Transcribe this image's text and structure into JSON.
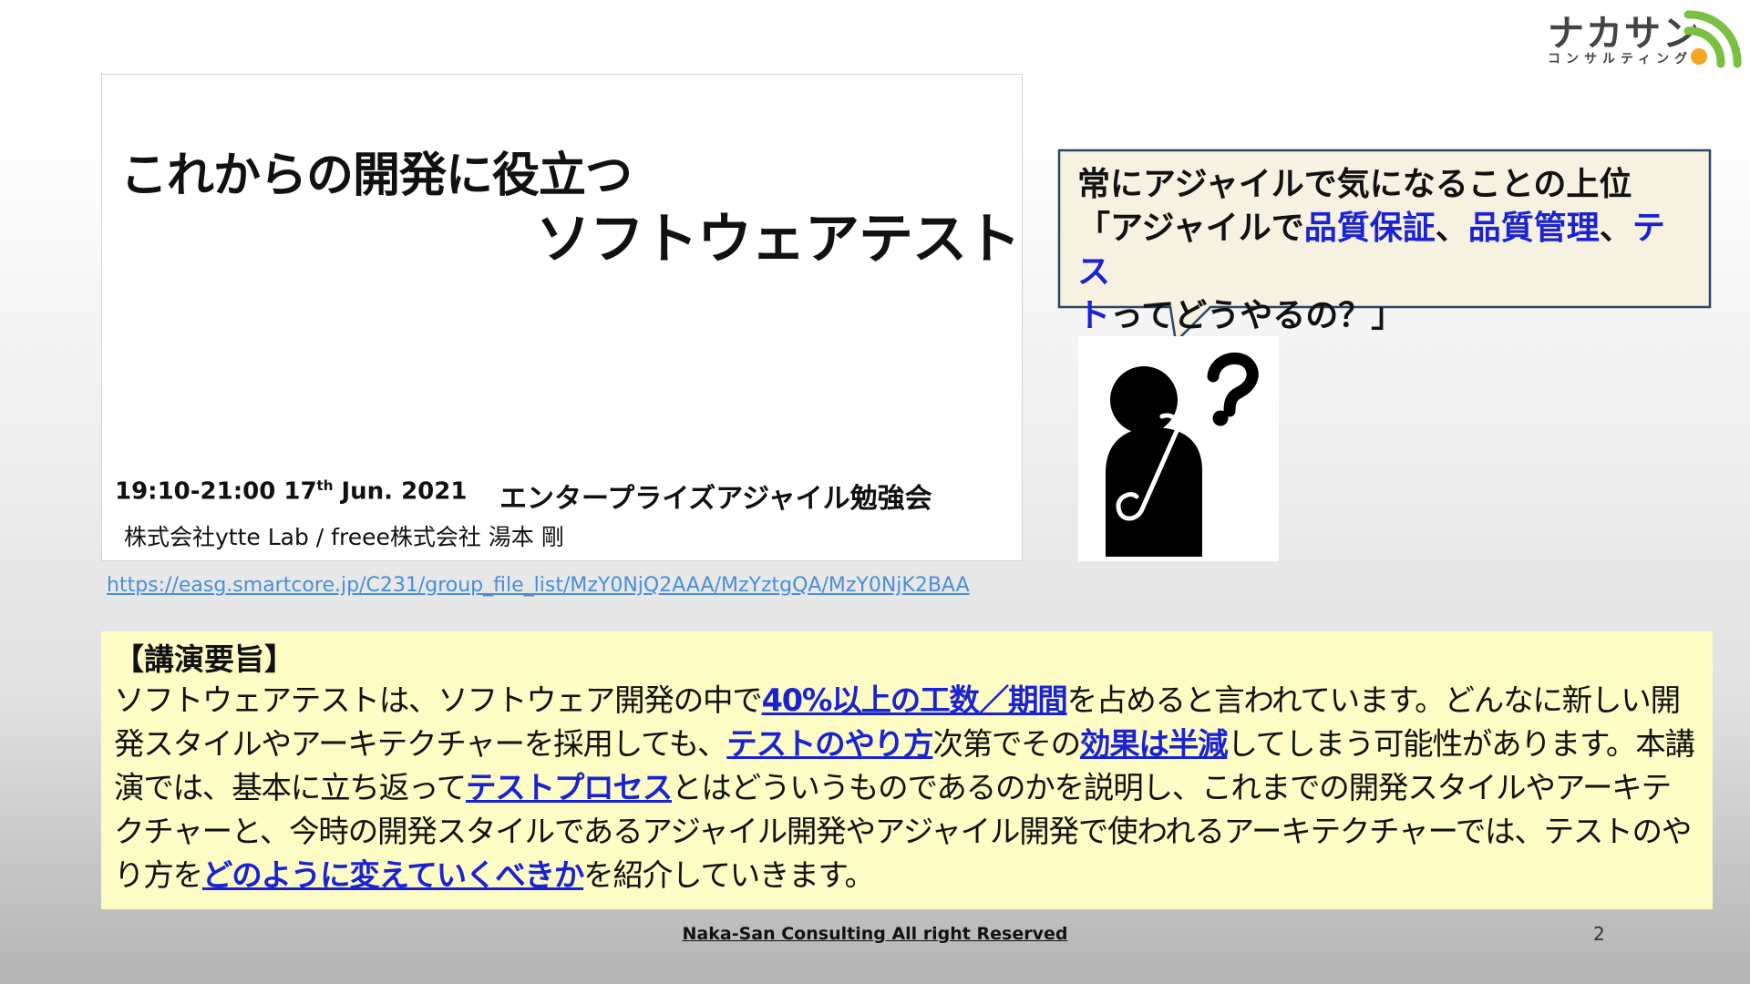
{
  "logo": {
    "main": "ナカサン",
    "sub": "コンサルティング",
    "colors": {
      "arc_green": "#7ac143",
      "arc_orange": "#f5a623"
    }
  },
  "slide_thumbnail": {
    "title_line1": "これからの開発に役立つ",
    "title_line2": "ソフトウェアテスト",
    "date_prefix": "19:10-21:00  17",
    "date_sup": "th",
    "date_suffix": " Jun. 2021",
    "event": "エンタープライズアジャイル勉強会",
    "author": "株式会社ytte Lab  / freee株式会社 湯本 剛"
  },
  "link": {
    "url": "https://easg.smartcore.jp/C231/group_file_list/MzY0NjQ2AAA/MzYztgQA/MzY0NjK2BAA"
  },
  "speech_bubble": {
    "line1": "常にアジャイルで気になることの上位",
    "part_a": "「アジャイルで",
    "hl_1": "品質保証",
    "sep_1": "、",
    "hl_2": "品質管理",
    "sep_2": "、",
    "hl_3a": "テス",
    "hl_3b": "ト",
    "part_b": "ってどうやるの？」"
  },
  "summary": {
    "heading": "【講演要旨】",
    "s1": "ソフトウェアテストは、ソフトウェア開発の中で",
    "e1": "40%以上の工数／期間",
    "s2": "を占めると言われています。どんなに新しい開発スタイルやアーキテクチャーを採用しても、",
    "e2": "テストのやり方",
    "s3": "次第でその",
    "e3": "効果は半減",
    "s4": "してしまう可能性があります。本講演では、基本に立ち返って",
    "e4": "テストプロセス",
    "s5": "とはどういうものであるのかを説明し、これまでの開発スタイルやアーキテクチャーと、今時の開発スタイルであるアジャイル開発やアジャイル開発で使われるアーキテクチャーでは、テストのやり方を",
    "e5": "どのように変えていくべきか",
    "s6": "を紹介していきます。"
  },
  "footer": {
    "copyright": "Naka-San Consulting All right Reserved",
    "page_number": "2"
  },
  "colors": {
    "highlight_blue": "#1a22d4",
    "summary_bg": "#fdfcc4",
    "bubble_bg": "#f6f1e1",
    "bubble_border": "#2d4565"
  }
}
